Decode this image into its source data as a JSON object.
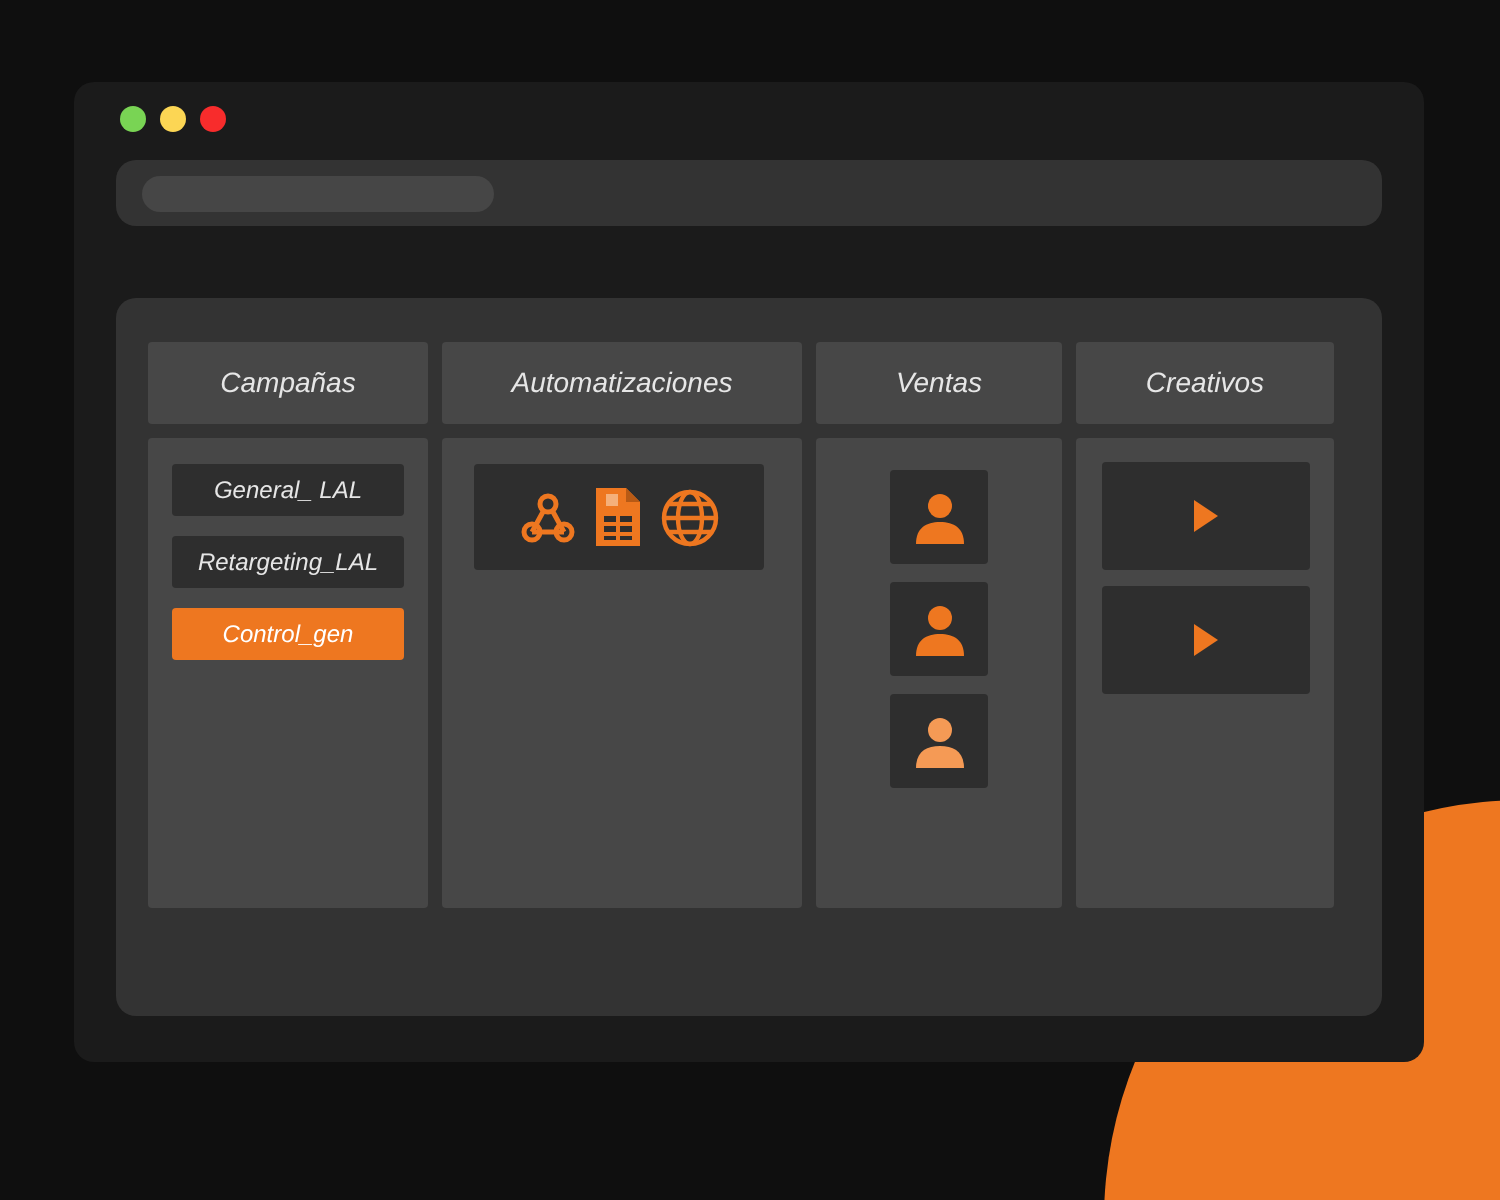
{
  "columns": [
    {
      "kind": "campaigns",
      "title": "Campañas",
      "items": [
        {
          "label": "General_ LAL",
          "selected": false
        },
        {
          "label": "Retargeting_LAL",
          "selected": false
        },
        {
          "label": "Control_gen",
          "selected": true
        }
      ]
    },
    {
      "kind": "automations",
      "title": "Automatizaciones"
    },
    {
      "kind": "sales",
      "title": "Ventas"
    },
    {
      "kind": "creatives",
      "title": "Creativos"
    }
  ]
}
